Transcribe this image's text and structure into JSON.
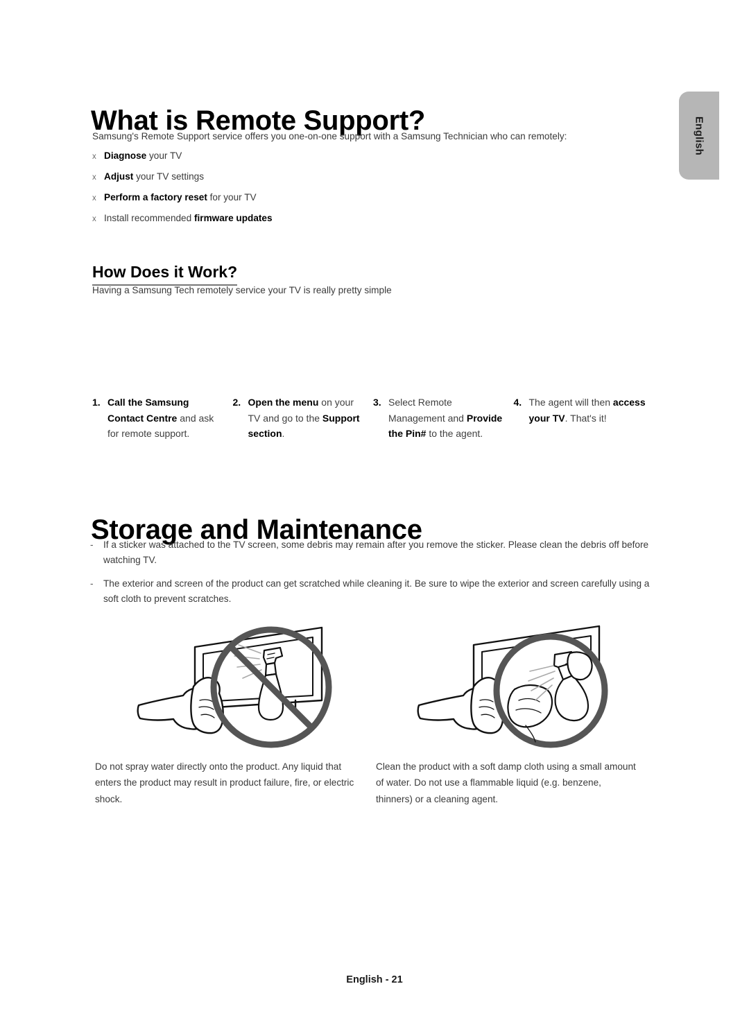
{
  "page": {
    "footer_label": "English - 21",
    "language_tab": "English"
  },
  "remote_support": {
    "title": "What is Remote Support?",
    "intro": "Samsung's Remote Support service offers you one-on-one support with a Samsung Technician who can remotely:",
    "bullet_marker": "x",
    "capabilities": [
      {
        "bold_lead": "Diagnose",
        "rest": " your TV",
        "lead_is_bold": true
      },
      {
        "bold_lead": "Adjust",
        "rest": " your TV settings",
        "lead_is_bold": true
      },
      {
        "bold_lead": "Perform a factory reset",
        "rest": " for your TV",
        "lead_is_bold": true
      },
      {
        "plain_lead": "Install recommended ",
        "bold_tail": "firmware updates",
        "lead_is_bold": false
      }
    ]
  },
  "how_it_works": {
    "title": "How Does it Work?",
    "intro": "Having a Samsung Tech remotely service your TV is really pretty simple",
    "steps": [
      {
        "number": "1.",
        "parts": [
          {
            "text": "Call the Samsung Contact Centre",
            "bold": true
          },
          {
            "text": " and ask for remote support.",
            "bold": false
          }
        ]
      },
      {
        "number": "2.",
        "parts": [
          {
            "text": "Open the menu",
            "bold": true
          },
          {
            "text": " on your TV and go to the ",
            "bold": false
          },
          {
            "text": "Support section",
            "bold": true
          },
          {
            "text": ".",
            "bold": false
          }
        ]
      },
      {
        "number": "3.",
        "parts": [
          {
            "text": "Select Remote Management and ",
            "bold": false
          },
          {
            "text": "Provide the Pin#",
            "bold": true
          },
          {
            "text": " to the agent.",
            "bold": false
          }
        ]
      },
      {
        "number": "4.",
        "parts": [
          {
            "text": "The agent will then ",
            "bold": false
          },
          {
            "text": "access your TV",
            "bold": true
          },
          {
            "text": ". That's it!",
            "bold": false
          }
        ]
      }
    ]
  },
  "storage_maintenance": {
    "title": "Storage and Maintenance",
    "bullet_marker": "-",
    "notes": [
      "If a sticker was attached to the TV screen, some debris may remain after you remove the sticker. Please clean the debris off before watching TV.",
      "The exterior and screen of the product can get scratched while cleaning it. Be sure to wipe the exterior and screen carefully using a soft cloth to prevent scratches."
    ],
    "figures": [
      {
        "name": "do-not-spray-water-on-tv",
        "caption": "Do not spray water directly onto the product. Any liquid that enters the product may result in product failure, fire, or electric shock."
      },
      {
        "name": "clean-with-damp-cloth",
        "caption": "Clean the product with a soft damp cloth using a small amount of water. Do not use a flammable liquid (e.g. benzene, thinners) or a cleaning agent."
      }
    ]
  },
  "colors": {
    "tab_gray": "#b6b6b6",
    "rule_gray": "#777777",
    "prohibition_gray": "#555555",
    "body_text": "#3a3a3a",
    "heading_text": "#000000"
  }
}
